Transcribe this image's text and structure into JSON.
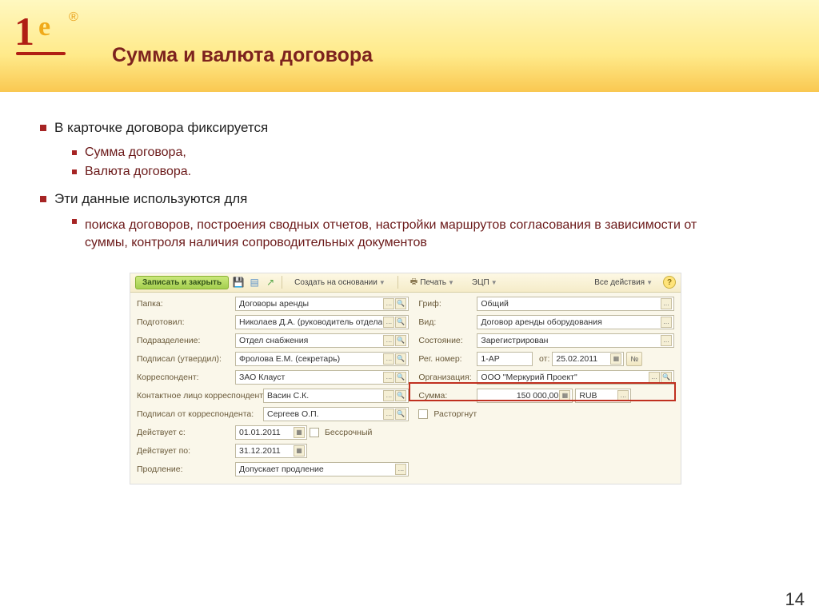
{
  "slide": {
    "title": "Сумма и валюта договора",
    "page_number": "14",
    "bullets": {
      "b1": "В карточке договора фиксируется",
      "b1_sub1": "Сумма договора,",
      "b1_sub2": "Валюта договора.",
      "b2": "Эти данные используются для",
      "b2_sub1": "поиска договоров, построения сводных отчетов, настройки маршрутов согласования в зависимости от суммы, контроля наличия сопроводительных документов"
    }
  },
  "toolbar": {
    "save_close": "Записать и закрыть",
    "create_based": "Создать на основании",
    "print": "Печать",
    "edc": "ЭЦП",
    "all_actions": "Все действия"
  },
  "form": {
    "left": {
      "folder_lbl": "Папка:",
      "folder_val": "Договоры аренды",
      "prepared_lbl": "Подготовил:",
      "prepared_val": "Николаев Д.А. (руководитель отдела",
      "dept_lbl": "Подразделение:",
      "dept_val": "Отдел снабжения",
      "signed_lbl": "Подписал (утвердил):",
      "signed_val": "Фролова Е.М. (секретарь)",
      "corr_lbl": "Корреспондент:",
      "corr_val": "ЗАО Клауст",
      "contact_lbl": "Контактное лицо корреспондента:",
      "contact_val": "Васин С.К.",
      "signed_corr_lbl": "Подписал от корреспондента:",
      "signed_corr_val": "Сергеев О.П.",
      "valid_from_lbl": "Действует с:",
      "valid_from_val": "01.01.2011",
      "valid_to_lbl": "Действует по:",
      "valid_to_val": "31.12.2011",
      "perpetual_lbl": "Бессрочный",
      "extension_lbl": "Продление:",
      "extension_val": "Допускает продление"
    },
    "right": {
      "grif_lbl": "Гриф:",
      "grif_val": "Общий",
      "type_lbl": "Вид:",
      "type_val": "Договор аренды оборудования",
      "status_lbl": "Состояние:",
      "status_val": "Зарегистрирован",
      "reg_lbl": "Рег. номер:",
      "reg_val": "1-АР",
      "from_lbl": "от:",
      "from_val": "25.02.2011",
      "num_btn": "№",
      "org_lbl": "Организация:",
      "org_val": "ООО \"Меркурий Проект\"",
      "sum_lbl": "Сумма:",
      "sum_val": "150 000,00",
      "currency_val": "RUB",
      "terminated_lbl": "Расторгнут"
    }
  }
}
